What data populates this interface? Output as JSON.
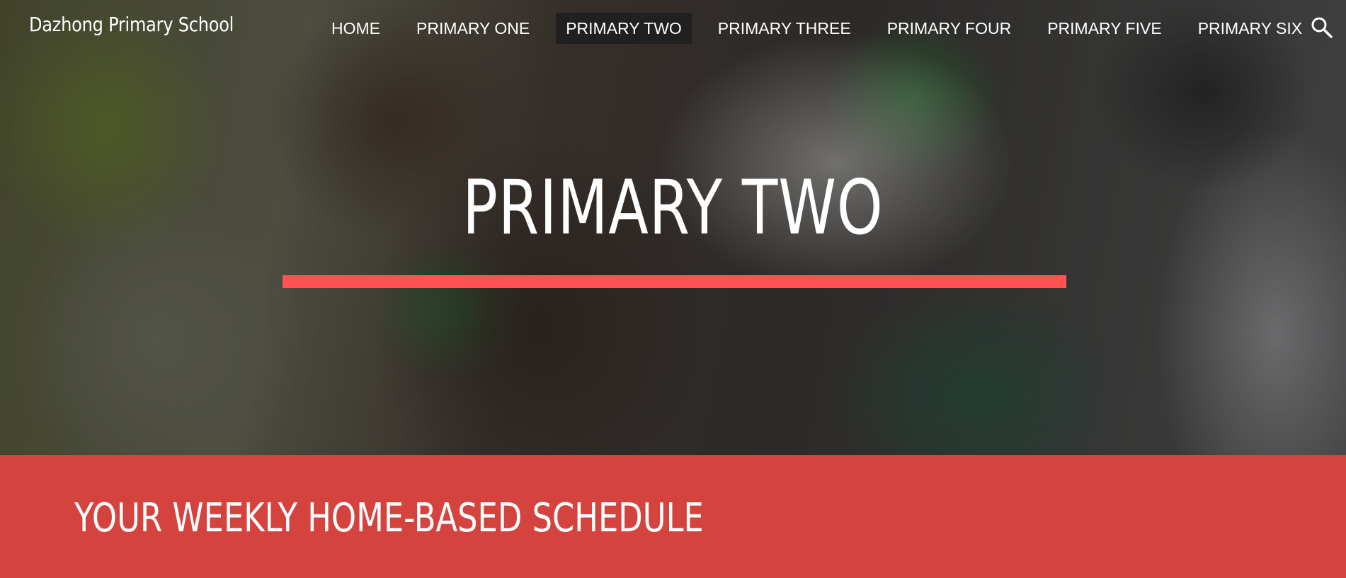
{
  "site": {
    "brand": "Dazhong Primary School"
  },
  "nav": {
    "items": [
      {
        "label": "HOME",
        "active": false
      },
      {
        "label": "PRIMARY ONE",
        "active": false
      },
      {
        "label": "PRIMARY TWO",
        "active": true
      },
      {
        "label": "PRIMARY THREE",
        "active": false
      },
      {
        "label": "PRIMARY FOUR",
        "active": false
      },
      {
        "label": "PRIMARY FIVE",
        "active": false
      },
      {
        "label": "PRIMARY SIX",
        "active": false
      }
    ],
    "search_icon": "search-icon"
  },
  "hero": {
    "title": "PRIMARY TWO",
    "image_alt": "",
    "accent_color": "#ff5252"
  },
  "banner": {
    "heading": "YOUR WEEKLY HOME-BASED SCHEDULE",
    "background_color": "#d5433f"
  }
}
